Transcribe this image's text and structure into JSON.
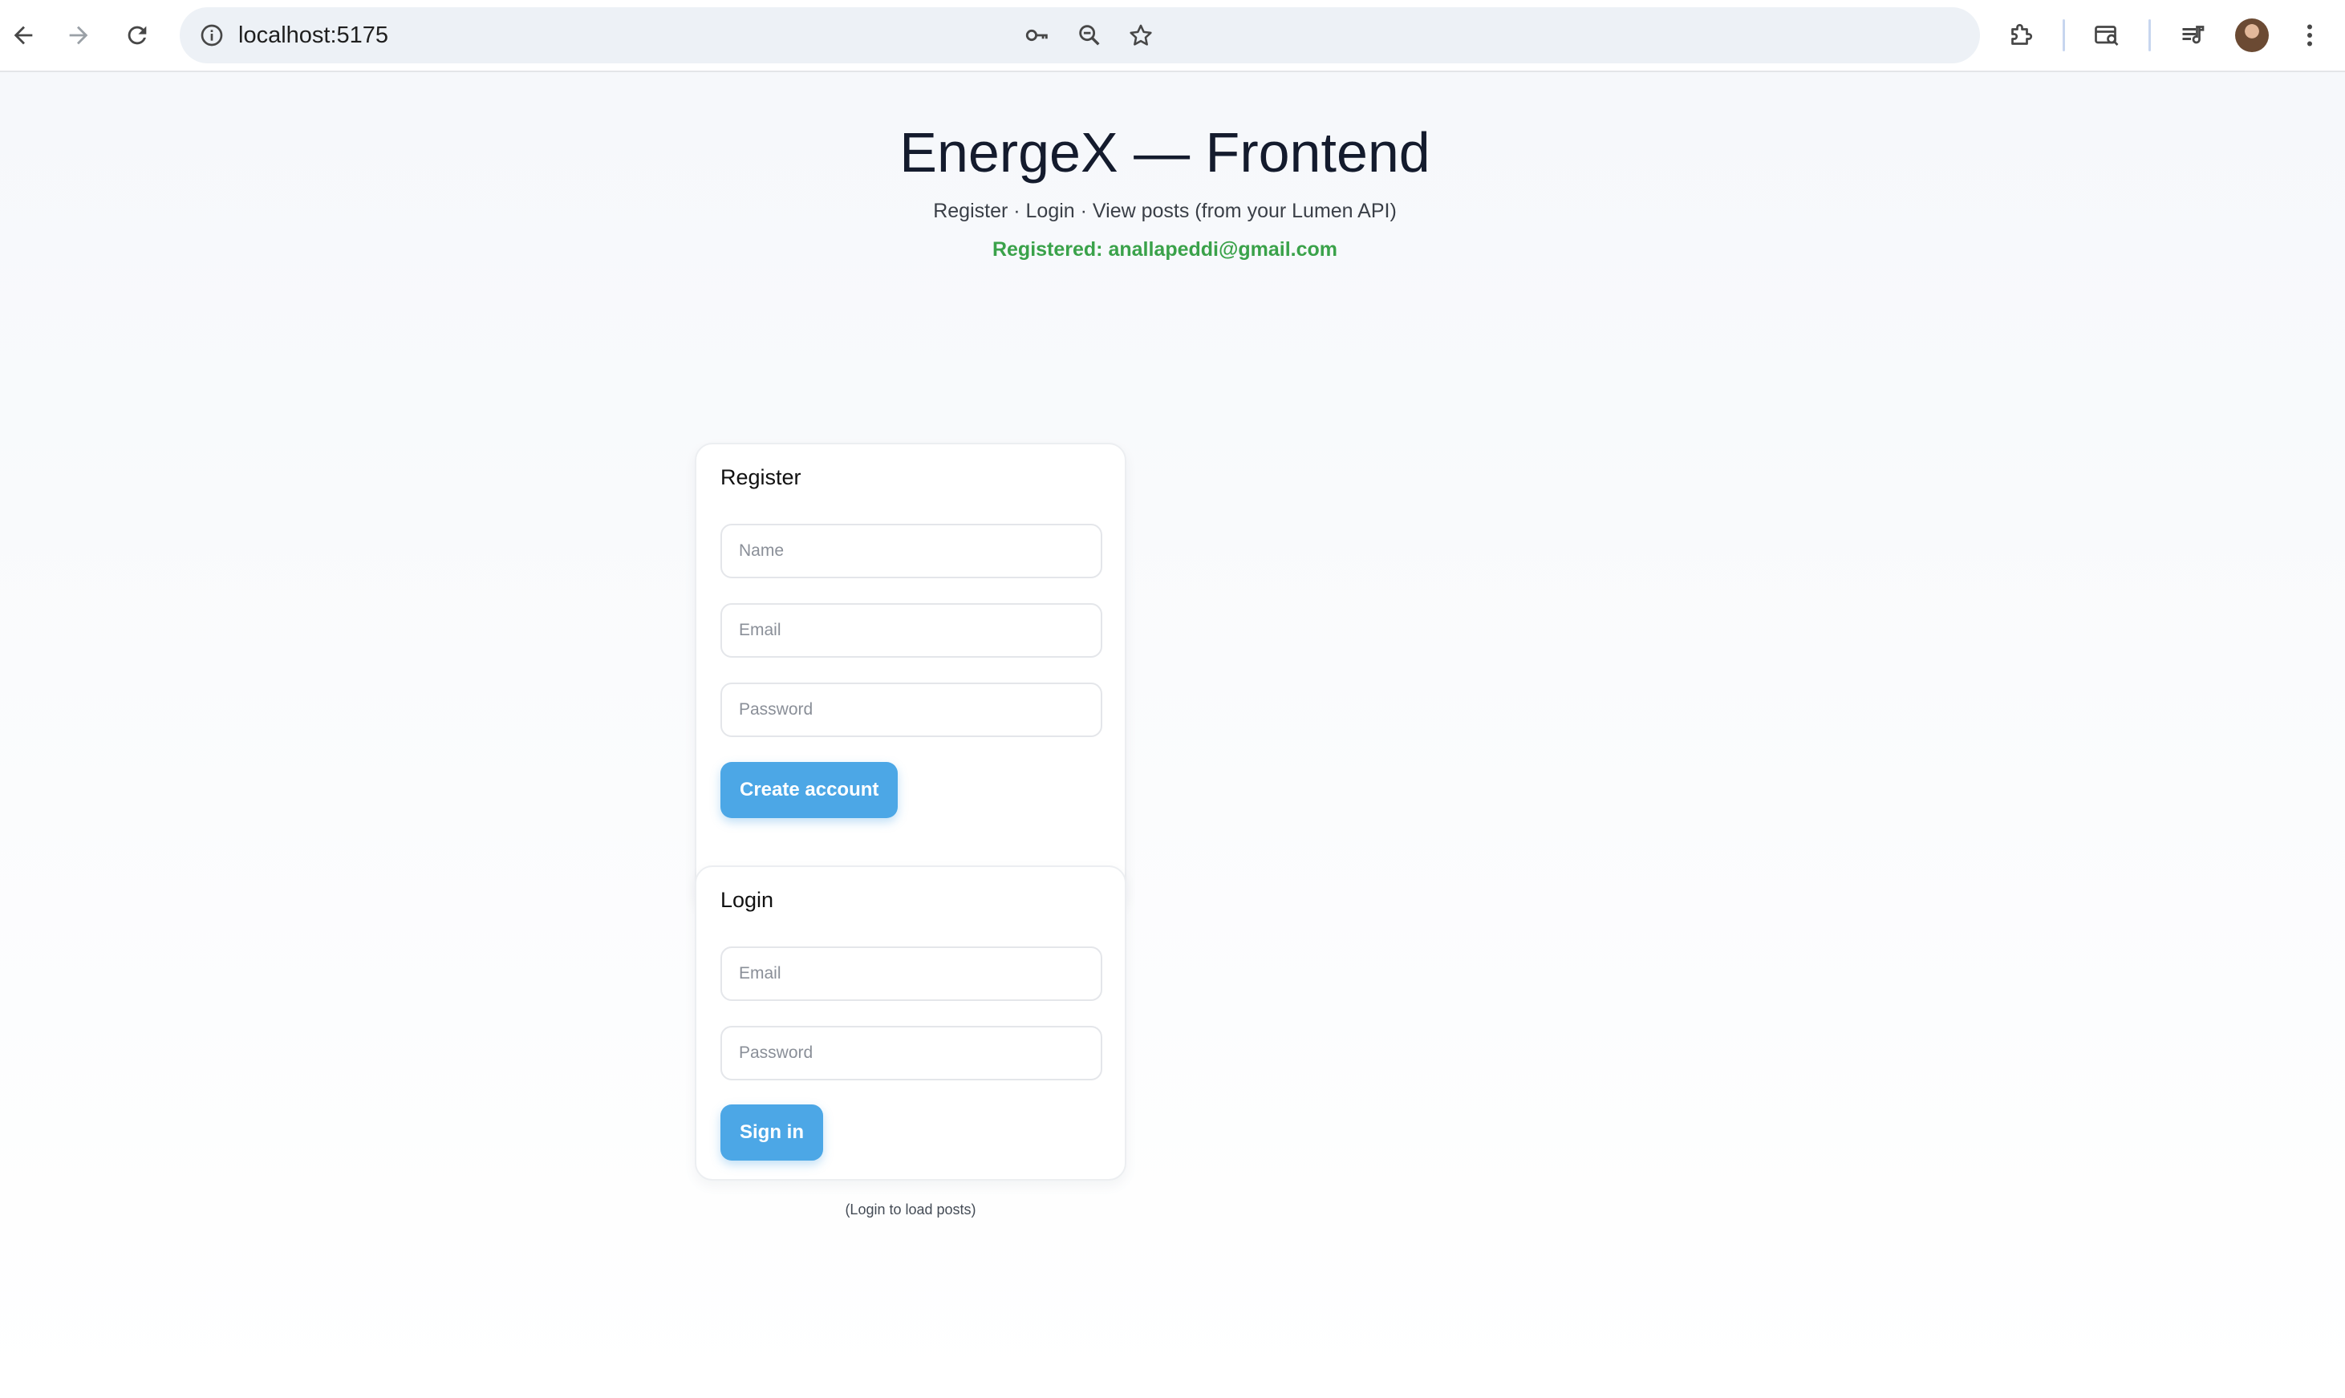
{
  "browser": {
    "url": "localhost:5175",
    "icons": {
      "back": "arrow-left-icon",
      "forward": "arrow-right-icon",
      "reload": "reload-icon",
      "site_info": "site-info-icon",
      "password": "key-icon",
      "zoom": "zoom-icon",
      "bookmark": "star-icon",
      "extensions": "puzzle-icon",
      "search_tabs": "tab-search-icon",
      "media": "media-controls-icon",
      "menu": "kebab-menu-icon"
    }
  },
  "header": {
    "title": "EnergeX — Frontend",
    "subtitle": "Register · Login · View posts (from your Lumen API)",
    "status": "Registered: anallapeddi@gmail.com",
    "status_color": "#3aa24a"
  },
  "register": {
    "title": "Register",
    "name_placeholder": "Name",
    "email_placeholder": "Email",
    "password_placeholder": "Password",
    "submit_label": "Create account"
  },
  "login": {
    "title": "Login",
    "email_placeholder": "Email",
    "password_placeholder": "Password",
    "submit_label": "Sign in"
  },
  "posts": {
    "hint": "(Login to load posts)"
  },
  "colors": {
    "accent": "#4ca7e6",
    "title_text": "#141b2d"
  }
}
